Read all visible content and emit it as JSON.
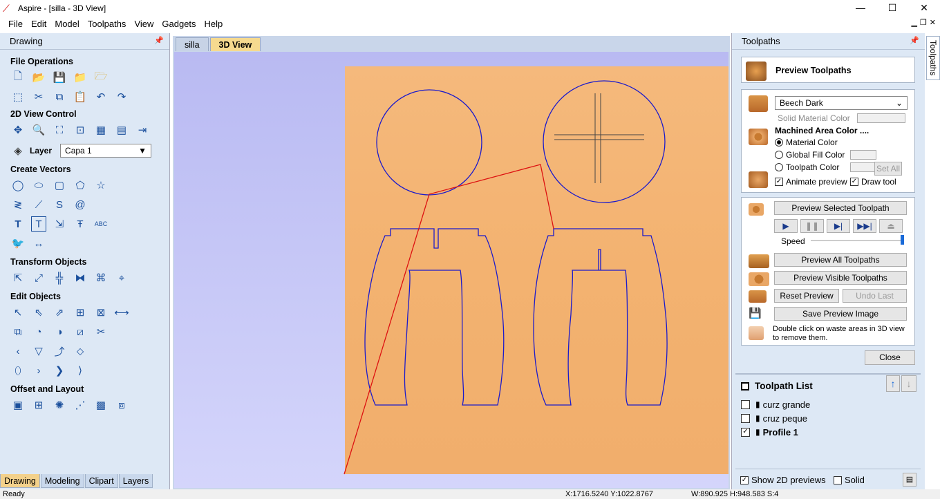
{
  "window": {
    "title": "Aspire - [silla - 3D View]",
    "minimize": "—",
    "maximize": "☐",
    "close": "✕"
  },
  "menu": [
    "File",
    "Edit",
    "Model",
    "Toolpaths",
    "View",
    "Gadgets",
    "Help"
  ],
  "left_panel": {
    "title": "Drawing",
    "sections": {
      "file_ops": "File Operations",
      "view_control": "2D View Control",
      "create_vectors": "Create Vectors",
      "transform": "Transform Objects",
      "edit": "Edit Objects",
      "offset": "Offset and Layout"
    },
    "layer_label": "Layer",
    "layer_value": "Capa 1",
    "bottom_tabs": [
      "Drawing",
      "Modeling",
      "Clipart",
      "Layers"
    ]
  },
  "doc_tabs": [
    "silla",
    "3D View"
  ],
  "right_panel": {
    "title": "Toolpaths",
    "side_tab": "Toolpaths",
    "header": "Preview Toolpaths",
    "material": "Beech Dark",
    "solid_material_color": "Solid Material Color",
    "machined_area_color": "Machined Area Color ....",
    "radio_material": "Material Color",
    "radio_global": "Global Fill Color",
    "radio_toolpath": "Toolpath Color",
    "set_all": "Set All",
    "animate_preview": "Animate preview",
    "draw_tool": "Draw tool",
    "preview_selected": "Preview Selected Toolpath",
    "speed": "Speed",
    "preview_all": "Preview All Toolpaths",
    "preview_visible": "Preview Visible Toolpaths",
    "reset_preview": "Reset Preview",
    "undo_last": "Undo Last",
    "save_preview": "Save Preview Image",
    "hint": "Double click on waste areas in 3D view to remove them.",
    "close": "Close",
    "toolpath_list_title": "Toolpath List",
    "toolpaths": [
      {
        "name": "curz grande",
        "checked": false
      },
      {
        "name": "cruz peque",
        "checked": false
      },
      {
        "name": "Profile 1",
        "checked": true
      }
    ],
    "show_2d_previews": "Show 2D previews",
    "solid": "Solid"
  },
  "status": {
    "left": "Ready",
    "coords": "X:1716.5240 Y:1022.8767",
    "dims": "W:890.925 H:948.583 S:4"
  }
}
